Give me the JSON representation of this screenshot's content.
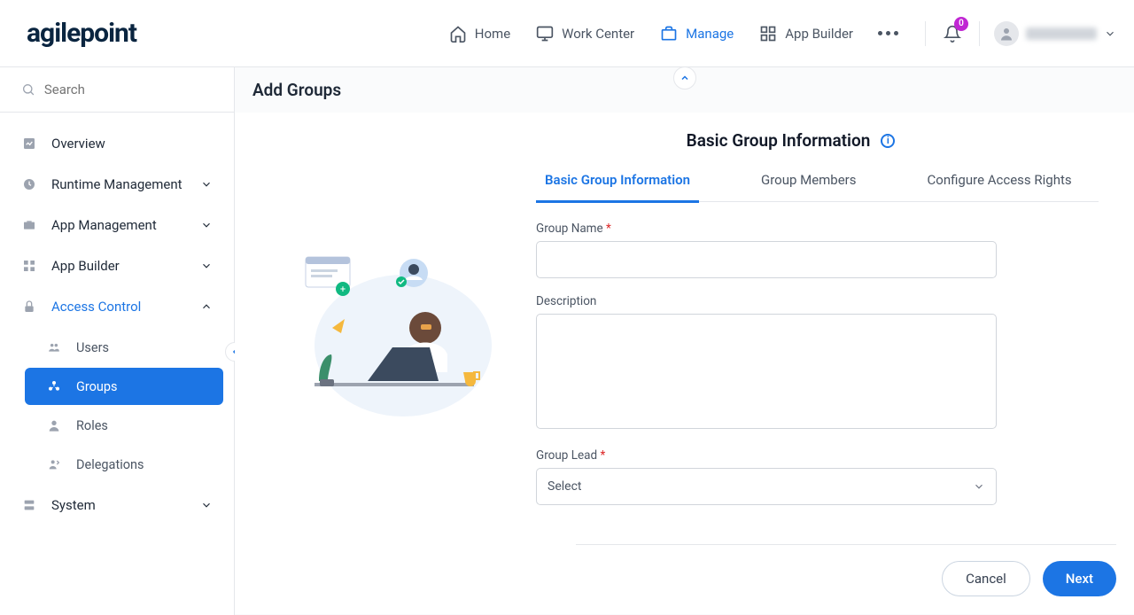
{
  "brand": "agilepoint",
  "nav": {
    "home": "Home",
    "work_center": "Work Center",
    "manage": "Manage",
    "app_builder": "App Builder"
  },
  "notification_count": "0",
  "search_placeholder": "Search",
  "sidebar": {
    "overview": "Overview",
    "runtime": "Runtime Management",
    "app_mgmt": "App Management",
    "app_builder": "App Builder",
    "access_control": "Access Control",
    "users": "Users",
    "groups": "Groups",
    "roles": "Roles",
    "delegations": "Delegations",
    "system": "System"
  },
  "page": {
    "title": "Add Groups",
    "section_title": "Basic Group Information",
    "tabs": {
      "basic": "Basic Group Information",
      "members": "Group Members",
      "rights": "Configure Access Rights"
    },
    "fields": {
      "group_name_label": "Group Name",
      "description_label": "Description",
      "group_lead_label": "Group Lead",
      "group_lead_placeholder": "Select",
      "required_marker": "*"
    },
    "actions": {
      "cancel": "Cancel",
      "next": "Next"
    }
  }
}
